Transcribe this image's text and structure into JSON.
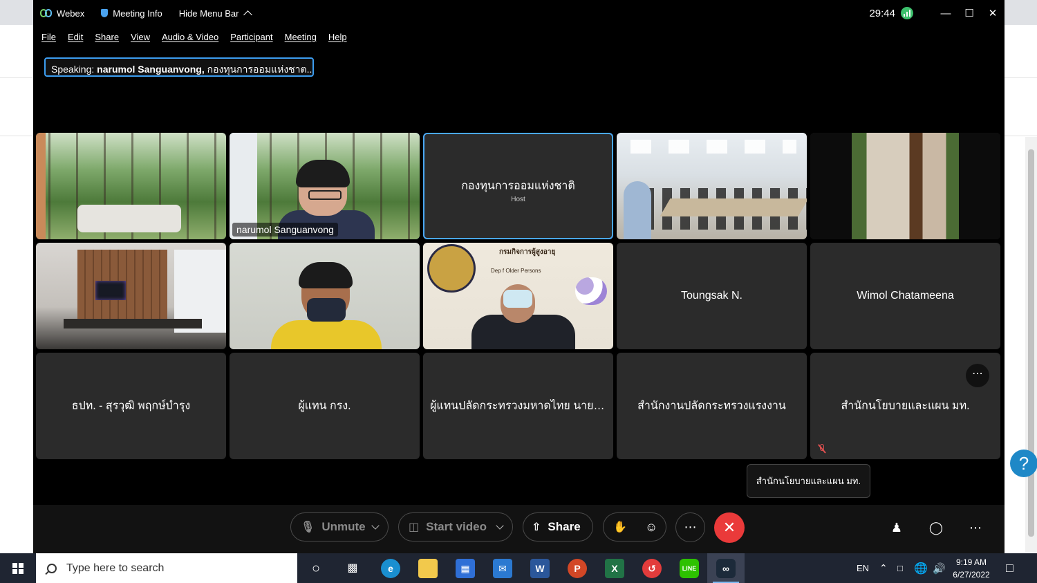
{
  "webex": {
    "app_name": "Webex",
    "meeting_info": "Meeting Info",
    "hide_menu_bar": "Hide Menu Bar",
    "timer": "29:44",
    "menus": [
      "File",
      "Edit",
      "Share",
      "View",
      "Audio & Video",
      "Participant",
      "Meeting",
      "Help"
    ],
    "speaking_prefix": "Speaking:",
    "speaking_name": "narumol Sanguanvong,",
    "speaking_rest": "กองทุนการออมแห่งชาต...",
    "tiles": [
      {
        "name": ""
      },
      {
        "name": "narumol Sanguanvong"
      },
      {
        "name": "กองทุนการออมแห่งชาติ",
        "sub": "Host"
      },
      {
        "name": ""
      },
      {
        "name": ""
      },
      {
        "name": ""
      },
      {
        "name": ""
      },
      {
        "name": "",
        "overlay_title": "กรมกิจการผู้สูงอายุ",
        "overlay_sub": "Dep        f Older Persons"
      },
      {
        "name": "Toungsak N."
      },
      {
        "name": "Wimol Chatameena"
      },
      {
        "name": "ธปท. - สุรวุฒิ พฤกษ์บำรุง"
      },
      {
        "name": "ผู้แทน กรง."
      },
      {
        "name": "ผู้แทนปลัดกระทรวงมหาดไทย นายช์..."
      },
      {
        "name": "สำนักงานปลัดกระทรวงแรงงาน"
      },
      {
        "name": "สำนักนโยบายและแผน มท."
      }
    ],
    "tooltip": "สำนักนโยบายและแผน มท.",
    "controls": {
      "unmute": "Unmute",
      "start_video": "Start video",
      "share": "Share"
    }
  },
  "taskbar": {
    "search_placeholder": "Type here to search",
    "lang": "EN",
    "time": "9:19 AM",
    "date": "6/27/2022"
  },
  "colors": {
    "active_border": "#4aa8f5",
    "end_call": "#ea3a3a",
    "tile_bg": "#2b2b2b"
  }
}
